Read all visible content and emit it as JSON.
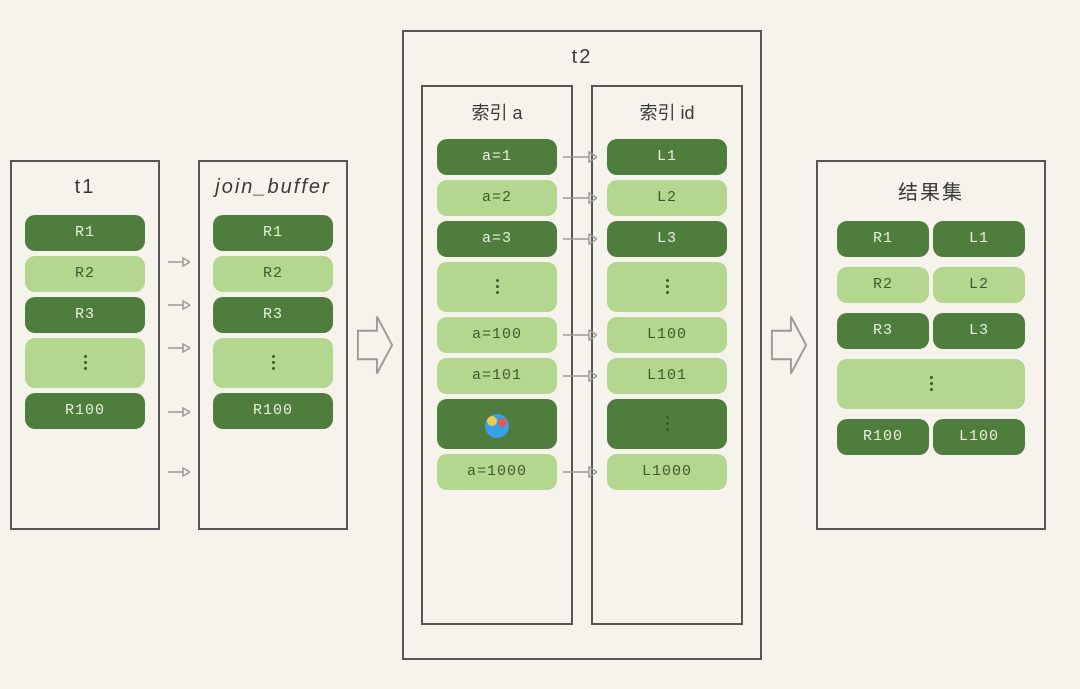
{
  "t1": {
    "title": "t1",
    "rows": [
      {
        "label": "R1",
        "shade": "dark"
      },
      {
        "label": "R2",
        "shade": "light"
      },
      {
        "label": "R3",
        "shade": "dark"
      },
      {
        "label": "",
        "shade": "light",
        "ellipsis": true,
        "tall": true
      },
      {
        "label": "R100",
        "shade": "dark"
      }
    ]
  },
  "join_buffer": {
    "title": "join_buffer",
    "rows": [
      {
        "label": "R1",
        "shade": "dark"
      },
      {
        "label": "R2",
        "shade": "light"
      },
      {
        "label": "R3",
        "shade": "dark"
      },
      {
        "label": "",
        "shade": "light",
        "ellipsis": true,
        "tall": true
      },
      {
        "label": "R100",
        "shade": "dark"
      }
    ]
  },
  "t2": {
    "title": "t2",
    "index_a": {
      "title": "索引 a",
      "rows": [
        {
          "label": "a=1",
          "shade": "dark",
          "arrow": true
        },
        {
          "label": "a=2",
          "shade": "light",
          "arrow": true
        },
        {
          "label": "a=3",
          "shade": "dark",
          "arrow": true
        },
        {
          "label": "",
          "shade": "light",
          "ellipsis": true,
          "tall": true
        },
        {
          "label": "a=100",
          "shade": "light",
          "arrow": true
        },
        {
          "label": "a=101",
          "shade": "light",
          "arrow": true
        },
        {
          "label": "",
          "shade": "dark",
          "tall": true,
          "watermark": true
        },
        {
          "label": "a=1000",
          "shade": "light",
          "arrow": true
        }
      ]
    },
    "index_id": {
      "title": "索引 id",
      "rows": [
        {
          "label": "L1",
          "shade": "dark"
        },
        {
          "label": "L2",
          "shade": "light"
        },
        {
          "label": "L3",
          "shade": "dark"
        },
        {
          "label": "",
          "shade": "light",
          "ellipsis": true,
          "tall": true
        },
        {
          "label": "L100",
          "shade": "light"
        },
        {
          "label": "L101",
          "shade": "light"
        },
        {
          "label": "",
          "shade": "dark",
          "ellipsis": true,
          "tall": true
        },
        {
          "label": "L1000",
          "shade": "light"
        }
      ]
    }
  },
  "result": {
    "title": "结果集",
    "rows": [
      {
        "left": "R1",
        "right": "L1",
        "shade": "dark"
      },
      {
        "left": "R2",
        "right": "L2",
        "shade": "light"
      },
      {
        "left": "R3",
        "right": "L3",
        "shade": "dark"
      },
      {
        "left": "",
        "right": "",
        "shade": "light",
        "ellipsis": true,
        "tall": true
      },
      {
        "left": "R100",
        "right": "L100",
        "shade": "dark"
      }
    ]
  },
  "arrow_positions_t1_to_jb": [
    0,
    43,
    86,
    150,
    210
  ]
}
